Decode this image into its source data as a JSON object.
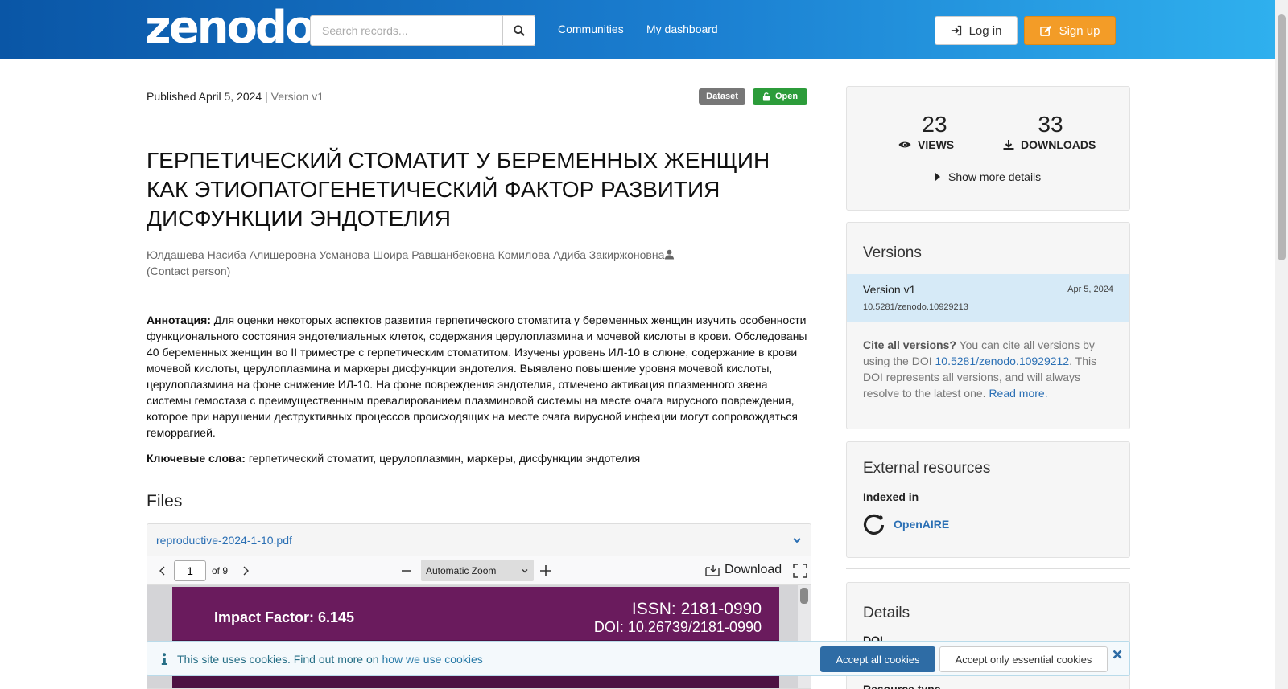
{
  "header": {
    "logo": "zenodo",
    "search_placeholder": "Search records...",
    "nav": [
      "Communities",
      "My dashboard"
    ],
    "login_label": "Log in",
    "signup_label": "Sign up"
  },
  "record": {
    "published": "Published April 5, 2024",
    "version": "| Version v1",
    "badges": {
      "type": "Dataset",
      "access": "Open"
    },
    "title": "ГЕРПЕТИЧЕСКИЙ СТОМАТИТ У БЕРЕМЕННЫХ ЖЕНЩИН КАК ЭТИОПАТОГЕНЕТИЧЕСКИЙ ФАКТОР РАЗВИТИЯ ДИСФУНКЦИИ ЭНДОТЕЛИЯ",
    "authors": "Юлдашева Насиба Алишеровна Усманова Шоира Равшанбековна Комилова Адиба Закиржоновна",
    "contact_role": "(Contact person)",
    "abstract_label": "Аннотация:",
    "abstract_text": " Для оценки некоторых аспектов развития герпетического стоматита у беременных женщин изучить особенности функционального состояния   эндотелиальных клеток, содержания церулоплазмина и мочевой кислоты в крови. Обследованы 40 беременных женщин во II триместре с герпетическим стоматитом. Изучены уровень ИЛ-10 в слюне, содержание в крови мочевой кислоты, церулоплазмина и маркеры дисфункции эндотелия. Выявлено повышение уровня мочевой кислоты, церулоплазмина на фоне снижение ИЛ-10. На фоне  повреждения эндотелия, отмечено активация плазменного звена системы гемостаза  с преимущественным превалированием плазминовой системы на месте очага вирусного повреждения, которое при нарушении  деструктивных процессов происходящих на месте очага вирусной инфекции могут сопровождаться геморрагией.",
    "keywords_label": "Ключевые слова:",
    "keywords_text": " герпетический стоматит, церулоплазмин, маркеры, дисфункции эндотелия"
  },
  "files": {
    "heading": "Files",
    "file_name": "reproductive-2024-1-10.pdf",
    "viewer": {
      "page": "1",
      "page_of": "of 9",
      "zoom": "Automatic Zoom",
      "download_label": "Download",
      "page_preview": {
        "impact_factor": "Impact Factor: 6.145",
        "issn": "ISSN: 2181-0990",
        "doi": "DOI: 10.26739/2181-0990"
      }
    }
  },
  "stats": {
    "views": "23",
    "views_label": "VIEWS",
    "downloads": "33",
    "downloads_label": "DOWNLOADS",
    "more_details": "Show more details"
  },
  "versions": {
    "title": "Versions",
    "current": {
      "label": "Version v1",
      "date": "Apr 5, 2024",
      "doi": "10.5281/zenodo.10929213"
    },
    "cite_bold": "Cite all versions?",
    "cite_text1": " You can cite all versions by using the DOI ",
    "cite_doi": "10.5281/zenodo.10929212",
    "cite_text2": ". This DOI represents all versions, and will always resolve to the latest one. ",
    "read_more": "Read more."
  },
  "external": {
    "title": "External resources",
    "indexed_in": "Indexed in",
    "openaire": "OpenAIRE"
  },
  "details": {
    "title": "Details",
    "doi_label": "DOI",
    "resource_type_label": "Resource type"
  },
  "cookie": {
    "text": "This site uses cookies. Find out more on ",
    "link": "how we use cookies",
    "accept_all": "Accept all cookies",
    "accept_essential": "Accept only essential cookies"
  },
  "colors": {
    "header_start": "#0a56a6",
    "header_end": "#2fb0ee",
    "signup": "#f39c27",
    "open_badge": "#2c9c3a",
    "link": "#2a6fb4"
  }
}
